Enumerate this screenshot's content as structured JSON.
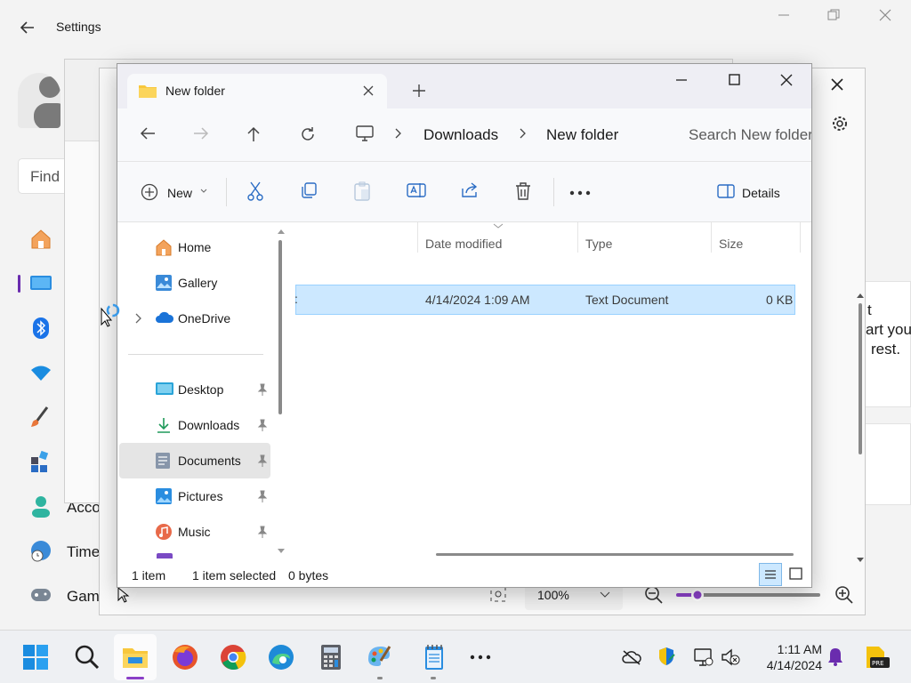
{
  "settings": {
    "title": "Settings",
    "find_placeholder": "Find",
    "nav": [
      {
        "label": "Acco",
        "icon": "accounts-icon"
      },
      {
        "label": "Time",
        "icon": "time-language-icon"
      },
      {
        "label": "Gam",
        "icon": "gaming-icon"
      }
    ],
    "right_text": [
      "t",
      "art you",
      "rest."
    ]
  },
  "explorer": {
    "tab_title": "New folder",
    "breadcrumbs": [
      "Downloads",
      "New folder"
    ],
    "search_placeholder": "Search New folder",
    "commands": {
      "new_label": "New",
      "details_label": "Details"
    },
    "nav_items": [
      {
        "label": "Home",
        "icon": "home-icon"
      },
      {
        "label": "Gallery",
        "icon": "gallery-icon"
      },
      {
        "label": "OneDrive",
        "icon": "onedrive-icon"
      },
      {
        "label": "Desktop",
        "icon": "desktop-folder-icon",
        "pinned": true
      },
      {
        "label": "Downloads",
        "icon": "downloads-folder-icon",
        "pinned": true
      },
      {
        "label": "Documents",
        "icon": "documents-folder-icon",
        "pinned": true,
        "selected": true
      },
      {
        "label": "Pictures",
        "icon": "pictures-folder-icon",
        "pinned": true
      },
      {
        "label": "Music",
        "icon": "music-folder-icon",
        "pinned": true
      }
    ],
    "columns": [
      "Date modified",
      "Type",
      "Size"
    ],
    "files": [
      {
        "name": "",
        "date_modified": "4/14/2024 1:09 AM",
        "type": "Text Document",
        "size": "0 KB",
        "selected": true
      }
    ],
    "status": {
      "item_count": "1 item",
      "selected": "1 item selected",
      "size": "0 bytes"
    }
  },
  "back_window": {
    "zoom_level": "100%"
  },
  "taskbar": {
    "clock_time": "1:11 AM",
    "clock_date": "4/14/2024",
    "colors": {
      "accent": "#0067c0",
      "selection": "#cce8ff"
    }
  }
}
